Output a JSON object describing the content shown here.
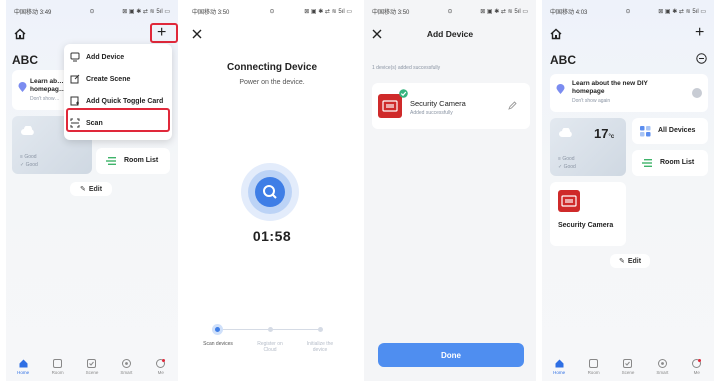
{
  "status_bar": {
    "carrier": "中国移动",
    "p1_time": "3:49",
    "p2_time": "3:50",
    "p3_time": "3:50",
    "p4_time": "4:03",
    "right": "⊠ ▣ ✱ ⇄ ≋ 5ıl ▭"
  },
  "home": {
    "title": "ABC",
    "card_text": "Learn ab… homepag…",
    "card_sub": "Don't show…",
    "weather_good1": "Good",
    "weather_good2": "Good",
    "temp": "17",
    "temp_unit": "°c",
    "room_list": "Room List",
    "edit": "Edit"
  },
  "menu": {
    "items": [
      "Add Device",
      "Create Scene",
      "Add Quick Toggle Card",
      "Scan"
    ]
  },
  "connecting": {
    "title": "Connecting Device",
    "subtitle": "Power on the device.",
    "timer": "01:58",
    "steps": [
      "Scan devices",
      "Register on Cloud",
      "Initialize the device"
    ]
  },
  "add_device": {
    "title": "Add Device",
    "count_text": "1 device(s) added successfully",
    "device_name": "Security Camera",
    "device_status": "Added successfully",
    "done": "Done"
  },
  "home_after": {
    "title": "ABC",
    "card_text": "Learn about the new DIY homepage",
    "card_sub": "Don't show again",
    "temp": "17",
    "temp_unit": "°c",
    "weather_good1": "Good",
    "weather_good2": "Good",
    "all_devices": "All Devices",
    "room_list": "Room List",
    "device_name": "Security Camera",
    "edit": "Edit"
  },
  "nav": {
    "items": [
      "Home",
      "Room",
      "Scene",
      "Smart",
      "Me"
    ]
  },
  "colors": {
    "accent": "#2f6fe4",
    "highlight": "#e0283a",
    "camera": "#cf2a2a",
    "done": "#4f8ef0"
  }
}
